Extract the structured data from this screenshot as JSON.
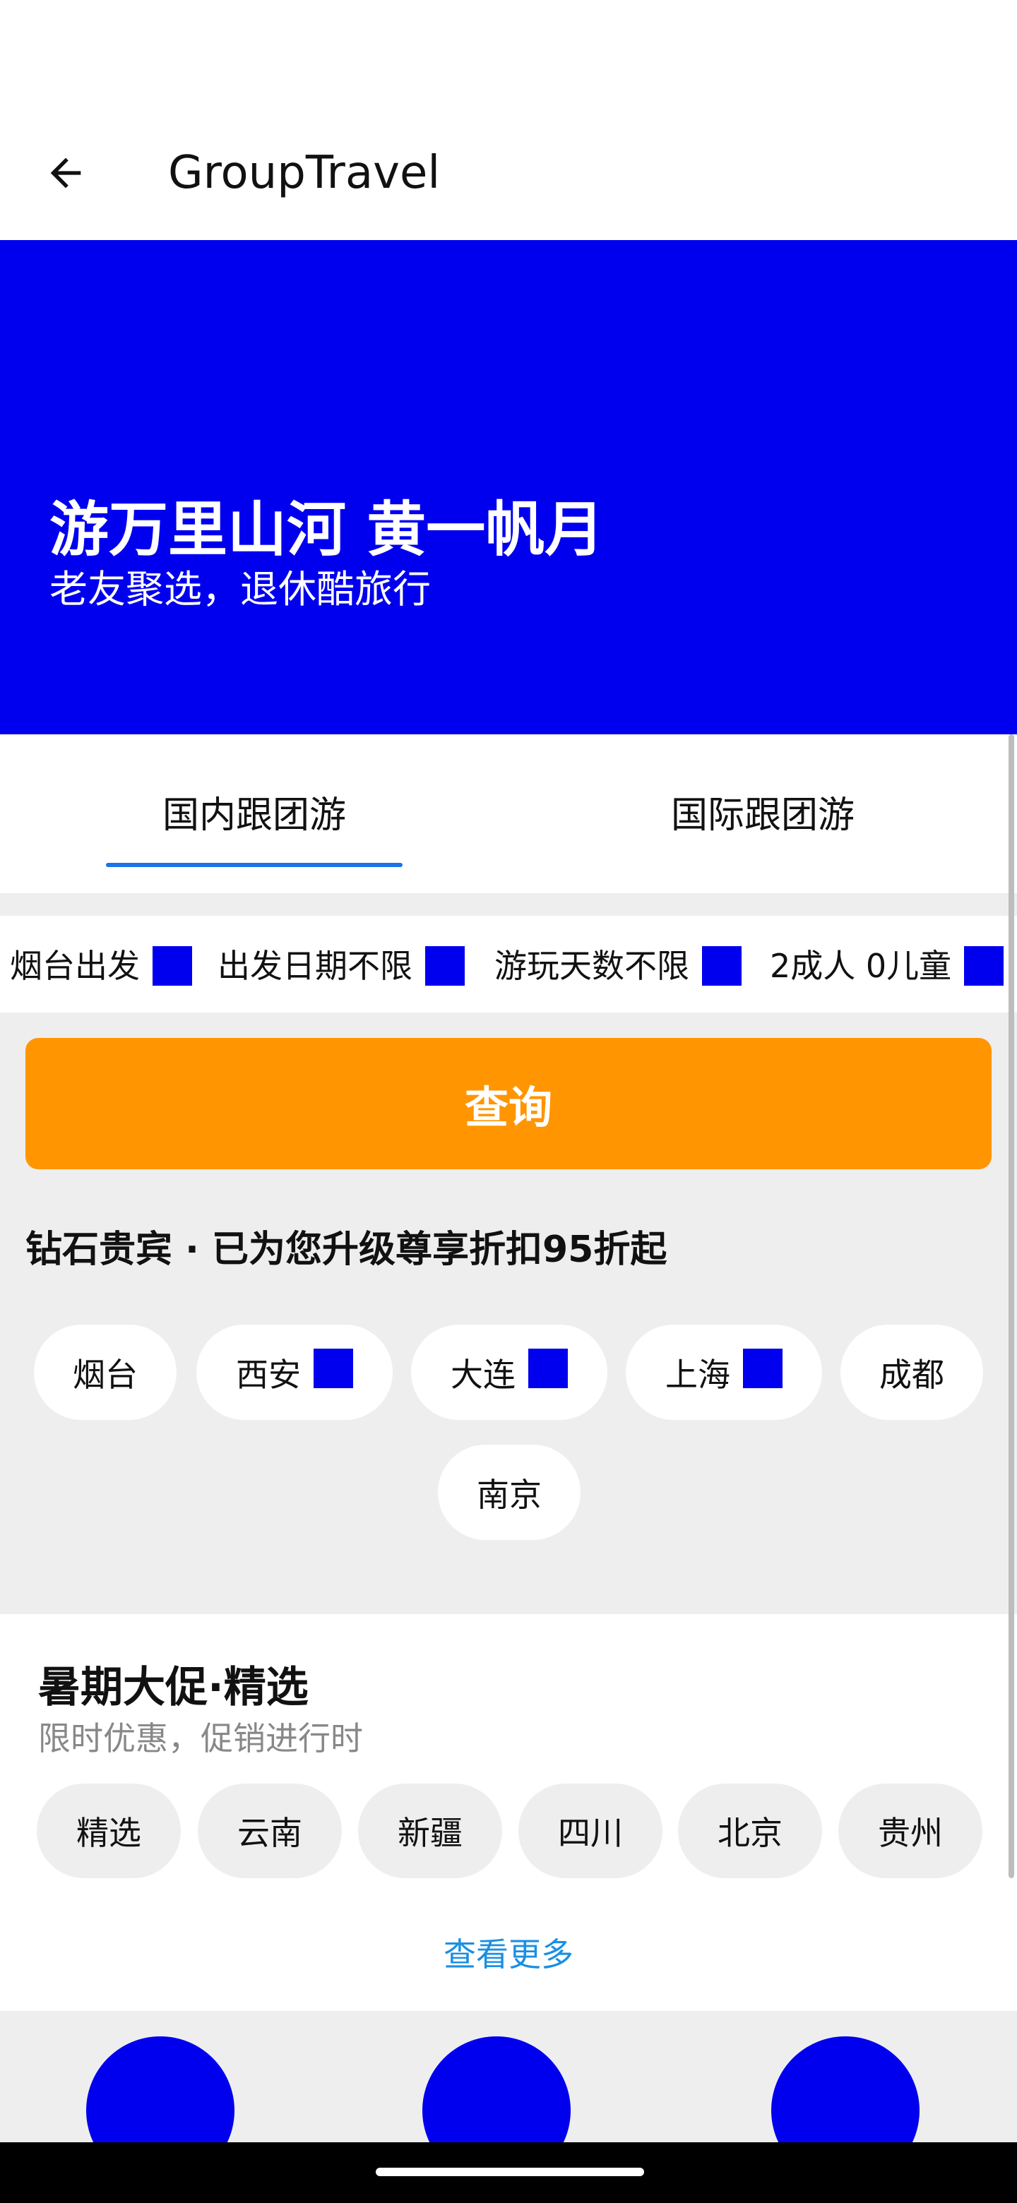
{
  "app_bar": {
    "title": "GroupTravel",
    "back_icon": "arrow-left-icon"
  },
  "hero": {
    "title": "游万里山河 黄一帆月",
    "subtitle": "老友聚选，退休酷旅行",
    "background": "#0000ee"
  },
  "tabs": [
    {
      "label": "国内跟团游",
      "selected": true
    },
    {
      "label": "国际跟团游",
      "selected": false
    }
  ],
  "filters": [
    {
      "label": "烟台出发"
    },
    {
      "label": "出发日期不限"
    },
    {
      "label": "游玩天数不限"
    },
    {
      "label": "2成人 0儿童"
    }
  ],
  "query_button": {
    "label": "查询",
    "color": "#ff9500"
  },
  "vip_text": "钻石贵宾 · 已为您升级尊享折扣95折起",
  "city_chips": [
    {
      "label": "烟台"
    },
    {
      "label": "西安"
    },
    {
      "label": "大连"
    },
    {
      "label": "上海"
    },
    {
      "label": "成都"
    },
    {
      "label": "南京"
    }
  ],
  "promo": {
    "title": "暑期大促·精选",
    "subtitle": "限时优惠，促销进行时",
    "chips": [
      "精选",
      "云南",
      "新疆",
      "四川",
      "北京",
      "贵州"
    ],
    "more_link": "查看更多"
  },
  "colors": {
    "accent_blue": "#0000ee",
    "tab_indicator": "#1a73e8",
    "link": "#1a8fe3"
  }
}
